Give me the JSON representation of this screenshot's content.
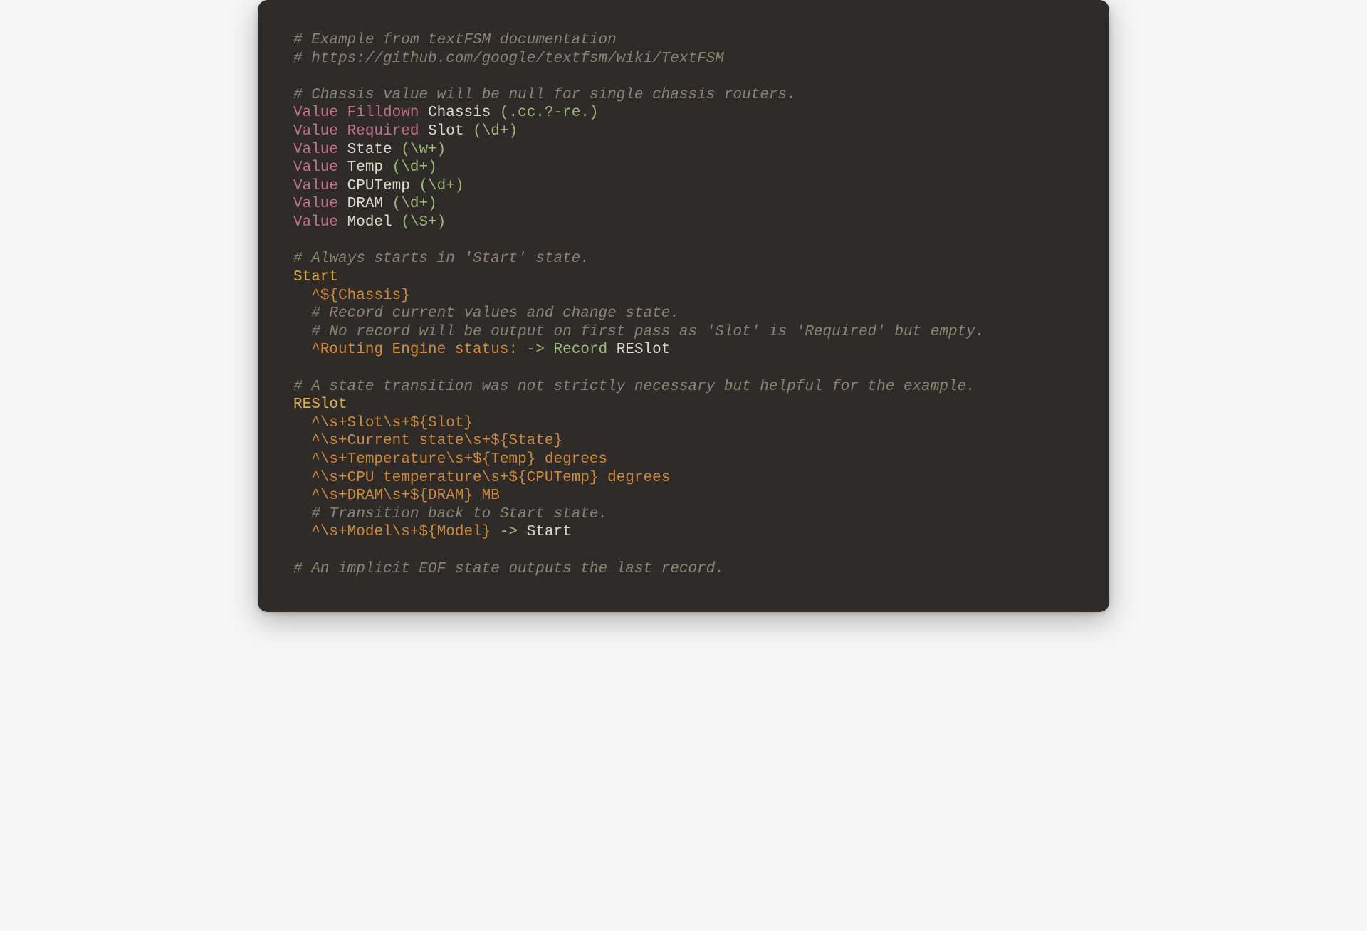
{
  "code": {
    "lines": [
      {
        "type": "comment",
        "text": "# Example from textFSM documentation"
      },
      {
        "type": "comment",
        "text": "# https://github.com/google/textfsm/wiki/TextFSM"
      },
      {
        "type": "blank"
      },
      {
        "type": "comment",
        "text": "# Chassis value will be null for single chassis routers."
      },
      {
        "type": "value",
        "kw": "Value",
        "opt": "Filldown",
        "name": "Chassis",
        "regex": "(.cc.?-re.)"
      },
      {
        "type": "value",
        "kw": "Value",
        "opt": "Required",
        "name": "Slot",
        "regex": "(\\d+)"
      },
      {
        "type": "value",
        "kw": "Value",
        "opt": null,
        "name": "State",
        "regex": "(\\w+)"
      },
      {
        "type": "value",
        "kw": "Value",
        "opt": null,
        "name": "Temp",
        "regex": "(\\d+)"
      },
      {
        "type": "value",
        "kw": "Value",
        "opt": null,
        "name": "CPUTemp",
        "regex": "(\\d+)"
      },
      {
        "type": "value",
        "kw": "Value",
        "opt": null,
        "name": "DRAM",
        "regex": "(\\d+)"
      },
      {
        "type": "value",
        "kw": "Value",
        "opt": null,
        "name": "Model",
        "regex": "(\\S+)"
      },
      {
        "type": "blank"
      },
      {
        "type": "comment",
        "text": "# Always starts in 'Start' state."
      },
      {
        "type": "state",
        "name": "Start"
      },
      {
        "type": "rule",
        "indent": "  ",
        "body": "^${Chassis}"
      },
      {
        "type": "comment-indent",
        "indent": "  ",
        "text": "# Record current values and change state."
      },
      {
        "type": "comment-indent",
        "indent": "  ",
        "text": "# No record will be output on first pass as 'Slot' is 'Required' but empty."
      },
      {
        "type": "rule-action",
        "indent": "  ",
        "body": "^Routing Engine status:",
        "arrow": " -> ",
        "action": "Record",
        "target": "RESlot"
      },
      {
        "type": "blank"
      },
      {
        "type": "comment",
        "text": "# A state transition was not strictly necessary but helpful for the example."
      },
      {
        "type": "state",
        "name": "RESlot"
      },
      {
        "type": "rule",
        "indent": "  ",
        "body": "^\\s+Slot\\s+${Slot}"
      },
      {
        "type": "rule",
        "indent": "  ",
        "body": "^\\s+Current state\\s+${State}"
      },
      {
        "type": "rule",
        "indent": "  ",
        "body": "^\\s+Temperature\\s+${Temp} degrees"
      },
      {
        "type": "rule",
        "indent": "  ",
        "body": "^\\s+CPU temperature\\s+${CPUTemp} degrees"
      },
      {
        "type": "rule",
        "indent": "  ",
        "body": "^\\s+DRAM\\s+${DRAM} MB"
      },
      {
        "type": "comment-indent",
        "indent": "  ",
        "text": "# Transition back to Start state."
      },
      {
        "type": "rule-action",
        "indent": "  ",
        "body": "^\\s+Model\\s+${Model}",
        "arrow": " -> ",
        "action": null,
        "target": "Start"
      },
      {
        "type": "blank"
      },
      {
        "type": "comment",
        "text": "# An implicit EOF state outputs the last record."
      }
    ]
  }
}
